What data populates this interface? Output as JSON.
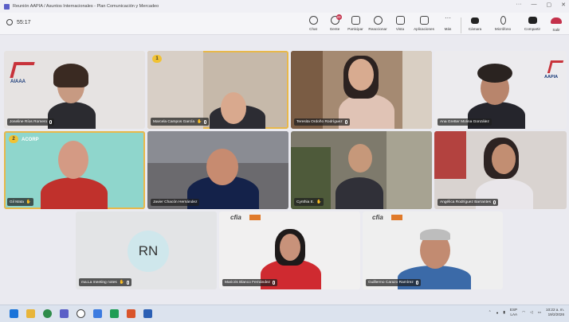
{
  "window": {
    "title": "Reunión AAPIA / Asuntos Internacionales - Plan Comunicación y Mercadeo",
    "controls": [
      "···",
      "—",
      "▢",
      "✕"
    ]
  },
  "toolbar": {
    "timer": "55:17",
    "chat": "Chat",
    "people": "Gente",
    "people_badge": "20",
    "participate": "Participar",
    "react": "Reaccionar",
    "view": "Vista",
    "apps": "Aplicaciones",
    "more": "Más",
    "camera": "Cámara",
    "mic": "Micrófono",
    "share": "Compartir",
    "leave": "Salir"
  },
  "tiles": [
    {
      "name": "Joseline Ríos Romero",
      "logo": "AIAAA"
    },
    {
      "name": "Marcela Campos García",
      "raise": "1"
    },
    {
      "name": "Teresita Ordoño Rodríguez"
    },
    {
      "name": "Ana Gretter Molina González",
      "logo": "AAPIA"
    },
    {
      "name": "Gil Mata",
      "raise": "2",
      "logo": "ACORP"
    },
    {
      "name": "Javier Chacón Hernández"
    },
    {
      "name": "Cynthia E."
    },
    {
      "name": "Angélica Rodríguez Barrantes"
    },
    {
      "name": "ma.La meeting notes",
      "initials": "RN"
    },
    {
      "name": "Maricris Blanco Fernández",
      "logo": "cfia"
    },
    {
      "name": "Guillermo Carazo Ramírez",
      "logo": "cfia"
    }
  ],
  "taskbar": {
    "lang1": "ESP",
    "lang2": "LAA",
    "time": "10:22 a. m.",
    "date": "19/2/2026"
  },
  "colors": {
    "accent": "#5b5fc7",
    "active_outline": "#e8b84a",
    "leave": "#c4314b"
  }
}
